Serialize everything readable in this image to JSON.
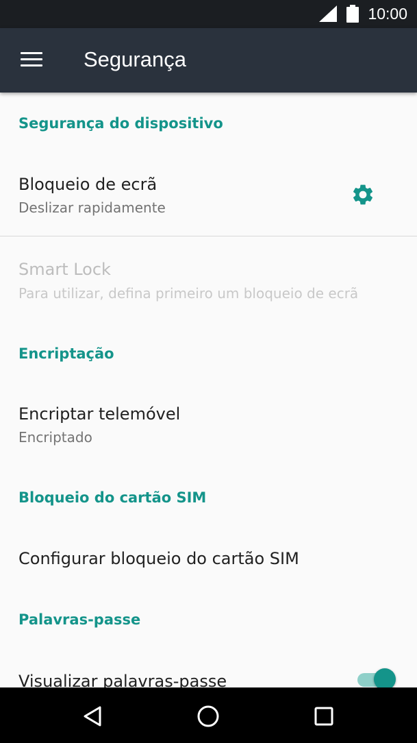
{
  "status_bar": {
    "time": "10:00",
    "icons": [
      "signal-icon",
      "battery-icon"
    ]
  },
  "app_bar": {
    "title": "Segurança",
    "menu_icon": "menu-icon"
  },
  "sections": {
    "device_security": {
      "header": "Segurança do dispositivo",
      "screen_lock": {
        "title": "Bloqueio de ecrã",
        "subtitle": "Deslizar rapidamente",
        "icon": "gear-icon"
      },
      "smart_lock": {
        "title": "Smart Lock",
        "subtitle": "Para utilizar, defina primeiro um bloqueio de ecrã",
        "enabled": false
      }
    },
    "encryption": {
      "header": "Encriptação",
      "encrypt_phone": {
        "title": "Encriptar telemóvel",
        "subtitle": "Encriptado"
      }
    },
    "sim_lock": {
      "header": "Bloqueio do cartão SIM",
      "configure": {
        "title": "Configurar bloqueio do cartão SIM"
      }
    },
    "passwords": {
      "header": "Palavras-passe",
      "show_passwords": {
        "title": "Visualizar palavras-passe",
        "toggle_on": true
      }
    }
  },
  "colors": {
    "accent": "#14948a",
    "app_bar": "#2a323d",
    "status_bar": "#1b1e22",
    "background": "#fafafa"
  },
  "nav_bar": {
    "buttons": [
      "back-icon",
      "home-icon",
      "recents-icon"
    ]
  }
}
